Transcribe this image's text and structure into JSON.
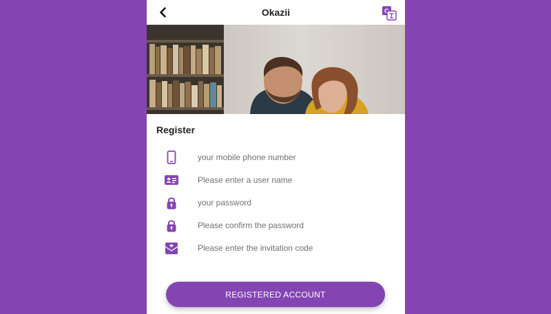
{
  "app": {
    "title": "Okazii",
    "accent": "#8445b3"
  },
  "header": {
    "back_icon": "chevron-left-icon",
    "translate_icon": "translate-icon"
  },
  "register": {
    "heading": "Register",
    "fields": [
      {
        "icon": "phone-icon",
        "placeholder": "your mobile phone number",
        "value": ""
      },
      {
        "icon": "id-card-icon",
        "placeholder": "Please enter a user name",
        "value": ""
      },
      {
        "icon": "lock-icon",
        "placeholder": "your password",
        "value": ""
      },
      {
        "icon": "lock-icon",
        "placeholder": "Please confirm the password",
        "value": ""
      },
      {
        "icon": "invitation-envelope-icon",
        "placeholder": "Please enter the invitation code",
        "value": ""
      }
    ],
    "submit_label": "REGISTERED ACCOUNT"
  }
}
